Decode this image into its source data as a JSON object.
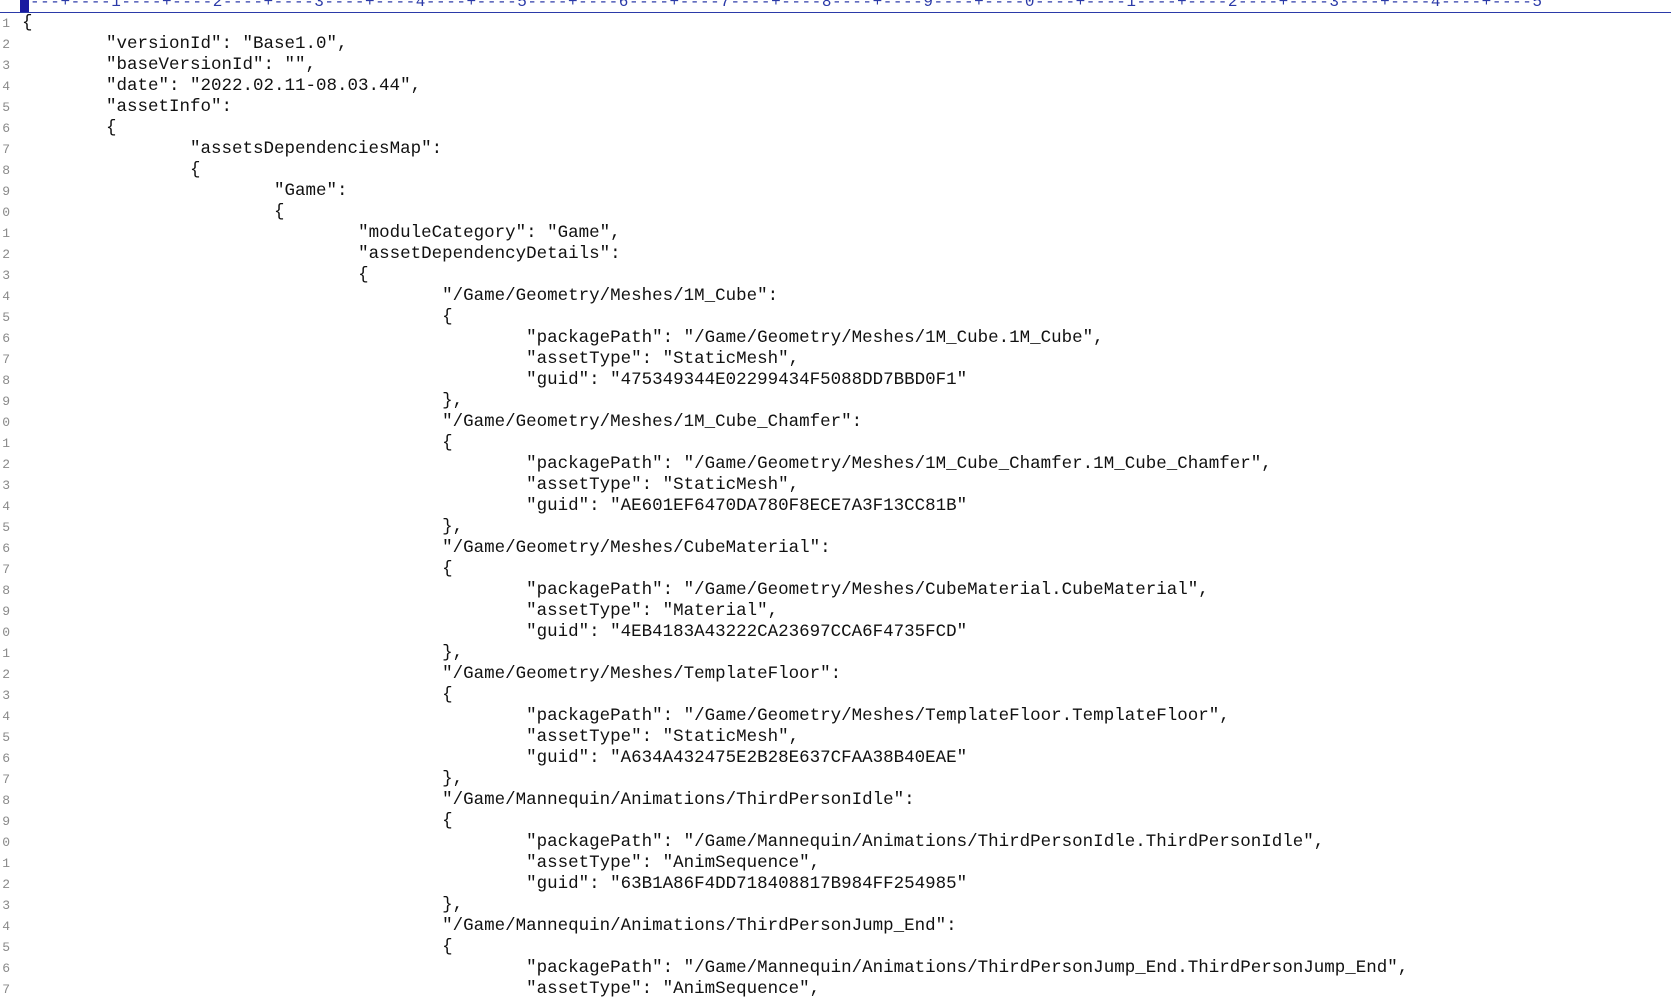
{
  "ruler": {
    "text": "---+----1----+----2----+----3----+----4----+----5----+----6----+----7----+----8----+----9----+----0----+----1----+----2----+----3----+----4----+----5"
  },
  "lines": [
    {
      "num": "1",
      "text": "{"
    },
    {
      "num": "2",
      "text": "\t\"versionId\": \"Base1.0\","
    },
    {
      "num": "3",
      "text": "\t\"baseVersionId\": \"\","
    },
    {
      "num": "4",
      "text": "\t\"date\": \"2022.02.11-08.03.44\","
    },
    {
      "num": "5",
      "text": "\t\"assetInfo\":"
    },
    {
      "num": "6",
      "text": "\t{"
    },
    {
      "num": "7",
      "text": "\t\t\"assetsDependenciesMap\":"
    },
    {
      "num": "8",
      "text": "\t\t{"
    },
    {
      "num": "9",
      "text": "\t\t\t\"Game\":"
    },
    {
      "num": "0",
      "text": "\t\t\t{"
    },
    {
      "num": "1",
      "text": "\t\t\t\t\"moduleCategory\": \"Game\","
    },
    {
      "num": "2",
      "text": "\t\t\t\t\"assetDependencyDetails\":"
    },
    {
      "num": "3",
      "text": "\t\t\t\t{"
    },
    {
      "num": "4",
      "text": "\t\t\t\t\t\"/Game/Geometry/Meshes/1M_Cube\":"
    },
    {
      "num": "5",
      "text": "\t\t\t\t\t{"
    },
    {
      "num": "6",
      "text": "\t\t\t\t\t\t\"packagePath\": \"/Game/Geometry/Meshes/1M_Cube.1M_Cube\","
    },
    {
      "num": "7",
      "text": "\t\t\t\t\t\t\"assetType\": \"StaticMesh\","
    },
    {
      "num": "8",
      "text": "\t\t\t\t\t\t\"guid\": \"475349344E02299434F5088DD7BBD0F1\""
    },
    {
      "num": "9",
      "text": "\t\t\t\t\t},"
    },
    {
      "num": "0",
      "text": "\t\t\t\t\t\"/Game/Geometry/Meshes/1M_Cube_Chamfer\":"
    },
    {
      "num": "1",
      "text": "\t\t\t\t\t{"
    },
    {
      "num": "2",
      "text": "\t\t\t\t\t\t\"packagePath\": \"/Game/Geometry/Meshes/1M_Cube_Chamfer.1M_Cube_Chamfer\","
    },
    {
      "num": "3",
      "text": "\t\t\t\t\t\t\"assetType\": \"StaticMesh\","
    },
    {
      "num": "4",
      "text": "\t\t\t\t\t\t\"guid\": \"AE601EF6470DA780F8ECE7A3F13CC81B\""
    },
    {
      "num": "5",
      "text": "\t\t\t\t\t},"
    },
    {
      "num": "6",
      "text": "\t\t\t\t\t\"/Game/Geometry/Meshes/CubeMaterial\":"
    },
    {
      "num": "7",
      "text": "\t\t\t\t\t{"
    },
    {
      "num": "8",
      "text": "\t\t\t\t\t\t\"packagePath\": \"/Game/Geometry/Meshes/CubeMaterial.CubeMaterial\","
    },
    {
      "num": "9",
      "text": "\t\t\t\t\t\t\"assetType\": \"Material\","
    },
    {
      "num": "0",
      "text": "\t\t\t\t\t\t\"guid\": \"4EB4183A43222CA23697CCA6F4735FCD\""
    },
    {
      "num": "1",
      "text": "\t\t\t\t\t},"
    },
    {
      "num": "2",
      "text": "\t\t\t\t\t\"/Game/Geometry/Meshes/TemplateFloor\":"
    },
    {
      "num": "3",
      "text": "\t\t\t\t\t{"
    },
    {
      "num": "4",
      "text": "\t\t\t\t\t\t\"packagePath\": \"/Game/Geometry/Meshes/TemplateFloor.TemplateFloor\","
    },
    {
      "num": "5",
      "text": "\t\t\t\t\t\t\"assetType\": \"StaticMesh\","
    },
    {
      "num": "6",
      "text": "\t\t\t\t\t\t\"guid\": \"A634A432475E2B28E637CFAA38B40EAE\""
    },
    {
      "num": "7",
      "text": "\t\t\t\t\t},"
    },
    {
      "num": "8",
      "text": "\t\t\t\t\t\"/Game/Mannequin/Animations/ThirdPersonIdle\":"
    },
    {
      "num": "9",
      "text": "\t\t\t\t\t{"
    },
    {
      "num": "0",
      "text": "\t\t\t\t\t\t\"packagePath\": \"/Game/Mannequin/Animations/ThirdPersonIdle.ThirdPersonIdle\","
    },
    {
      "num": "1",
      "text": "\t\t\t\t\t\t\"assetType\": \"AnimSequence\","
    },
    {
      "num": "2",
      "text": "\t\t\t\t\t\t\"guid\": \"63B1A86F4DD718408817B984FF254985\""
    },
    {
      "num": "3",
      "text": "\t\t\t\t\t},"
    },
    {
      "num": "4",
      "text": "\t\t\t\t\t\"/Game/Mannequin/Animations/ThirdPersonJump_End\":"
    },
    {
      "num": "5",
      "text": "\t\t\t\t\t{"
    },
    {
      "num": "6",
      "text": "\t\t\t\t\t\t\"packagePath\": \"/Game/Mannequin/Animations/ThirdPersonJump_End.ThirdPersonJump_End\","
    },
    {
      "num": "7",
      "text": "\t\t\t\t\t\t\"assetType\": \"AnimSequence\","
    }
  ]
}
